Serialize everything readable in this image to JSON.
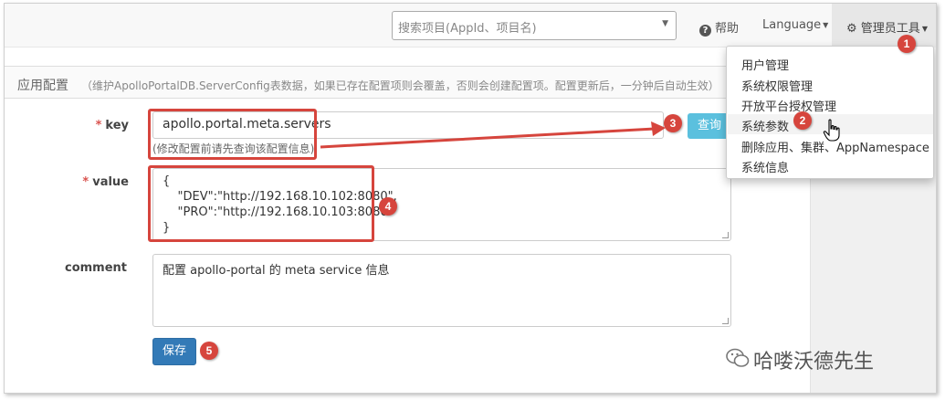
{
  "navbar": {
    "search_placeholder": "搜索项目(AppId、项目名)",
    "help_label": "帮助",
    "language_label": "Language",
    "admin_label": "管理员工具"
  },
  "dropdown": {
    "items": [
      {
        "label": "用户管理"
      },
      {
        "label": "系统权限管理"
      },
      {
        "label": "开放平台授权管理"
      },
      {
        "label": "系统参数"
      },
      {
        "label": "删除应用、集群、AppNamespace"
      },
      {
        "label": "系统信息"
      }
    ]
  },
  "panel": {
    "title": "应用配置",
    "subtitle": "（维护ApolloPortalDB.ServerConfig表数据，如果已存在配置项则会覆盖，否则会创建配置项。配置更新后，一分钟后自动生效）"
  },
  "form": {
    "key_label": "key",
    "key_value": "apollo.portal.meta.servers",
    "key_help": "(修改配置前请先查询该配置信息)",
    "query_button": "查询",
    "value_label": "value",
    "value_lines": [
      "{",
      "    \"DEV\":\"http://192.168.10.102:8080\",",
      "    \"PRO\":\"http://192.168.10.103:8080\"",
      "}"
    ],
    "comment_label": "comment",
    "comment_value": "配置 apollo-portal 的 meta service 信息",
    "save_button": "保存",
    "required_mark": "*"
  },
  "annotations": {
    "badge_1": "1",
    "badge_2": "2",
    "badge_3": "3",
    "badge_4": "4",
    "badge_5": "5"
  },
  "watermark": {
    "text": "哈喽沃德先生"
  },
  "colors": {
    "annotation_red": "#d6453d",
    "query_button": "#5bc0de",
    "save_button": "#337ab7",
    "required_star": "#d9534f"
  },
  "icons": {
    "help": "question-circle-icon",
    "admin": "gear-icon",
    "cursor": "hand-pointer-icon",
    "watermark": "wechat-icon"
  }
}
